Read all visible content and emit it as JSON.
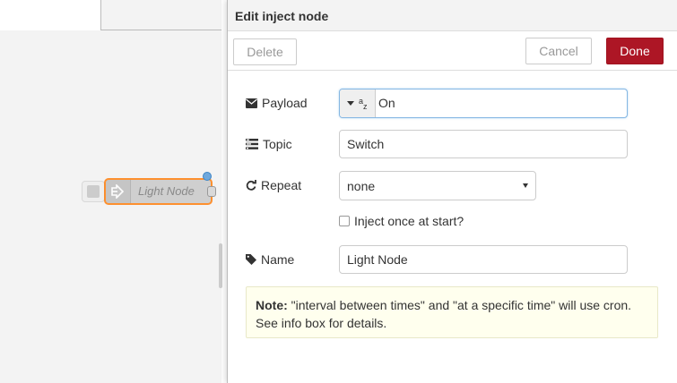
{
  "tray": {
    "title": "Edit inject node",
    "delete_label": "Delete",
    "cancel_label": "Cancel",
    "done_label": "Done"
  },
  "node": {
    "label": "Light Node"
  },
  "form": {
    "payload_label": "Payload",
    "payload_value": "On",
    "payload_type_glyph_a": "a",
    "payload_type_glyph_z": "z",
    "topic_label": "Topic",
    "topic_value": "Switch",
    "repeat_label": "Repeat",
    "repeat_value": "none",
    "inject_once_label": "Inject once at start?",
    "name_label": "Name",
    "name_value": "Light Node"
  },
  "note": {
    "bold": "Note:",
    "text": " \"interval between times\" and \"at a specific time\" will use cron. See info box for details."
  },
  "colors": {
    "done_button": "#ad1625",
    "node_selected_border": "#ff7f0e",
    "note_background": "#ffffee"
  }
}
